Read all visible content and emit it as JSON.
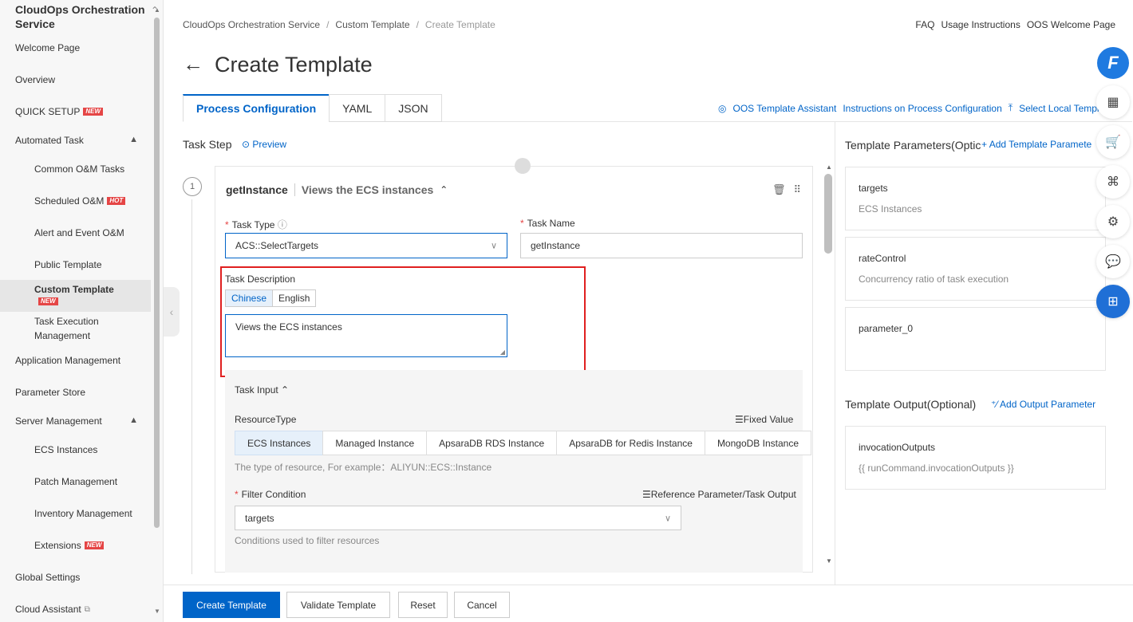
{
  "sidebar": {
    "title": "CloudOps Orchestration Service",
    "items": [
      {
        "label": "Welcome Page"
      },
      {
        "label": "Overview"
      },
      {
        "label": "QUICK SETUP",
        "badge": "NEW"
      },
      {
        "label": "Automated Task"
      },
      {
        "label": "Common O&M Tasks"
      },
      {
        "label": "Scheduled O&M",
        "badge": "HOT"
      },
      {
        "label": "Alert and Event O&M"
      },
      {
        "label": "Public Template"
      },
      {
        "label": "Custom Template",
        "badge": "NEW"
      },
      {
        "label": "Task Execution Management"
      },
      {
        "label": "Application Management"
      },
      {
        "label": "Parameter Store"
      },
      {
        "label": "Server Management"
      },
      {
        "label": "ECS Instances"
      },
      {
        "label": "Patch Management"
      },
      {
        "label": "Inventory Management"
      },
      {
        "label": "Extensions",
        "badge": "NEW"
      },
      {
        "label": "Global Settings"
      },
      {
        "label": "Cloud Assistant"
      }
    ]
  },
  "breadcrumb": [
    "CloudOps Orchestration Service",
    "Custom Template",
    "Create Template"
  ],
  "top_links": [
    "FAQ",
    "Usage Instructions",
    "OOS Welcome Page"
  ],
  "page_title": "Create Template",
  "tabs": [
    "Process Configuration",
    "YAML",
    "JSON"
  ],
  "tab_links": {
    "assistant": "OOS Template Assistant",
    "instructions": "Instructions on Process Configuration",
    "select_local": "Select Local Templ"
  },
  "task_step": {
    "label": "Task Step",
    "preview": "Preview"
  },
  "task": {
    "number": "1",
    "name": "getInstance",
    "description_title": "Views the ECS instances",
    "type_label": "Task Type",
    "type_value": "ACS::SelectTargets",
    "name_label": "Task Name",
    "name_value": "getInstance",
    "desc_label": "Task Description",
    "lang_options": [
      "Chinese",
      "English"
    ],
    "desc_value": "Views the ECS instances",
    "input_label": "Task Input",
    "resource_type_label": "ResourceType",
    "fixed_value": "Fixed Value",
    "resource_types": [
      "ECS Instances",
      "Managed Instance",
      "ApsaraDB RDS Instance",
      "ApsaraDB for Redis Instance",
      "MongoDB Instance"
    ],
    "resource_hint": "The type of resource, For example：ALIYUN::ECS::Instance",
    "filter_label": "Filter Condition",
    "reference_link": "Reference Parameter/Task Output",
    "filter_value": "targets",
    "filter_hint": "Conditions used to filter resources"
  },
  "params": {
    "title": "Template Parameters(Optic",
    "add": "Add Template Paramete",
    "items": [
      {
        "name": "targets",
        "desc": "ECS Instances"
      },
      {
        "name": "rateControl",
        "desc": "Concurrency ratio of task execution"
      },
      {
        "name": "parameter_0",
        "desc": ""
      }
    ]
  },
  "outputs": {
    "title": "Template Output(Optional)",
    "add": "Add Output Parameter",
    "items": [
      {
        "name": "invocationOutputs",
        "desc": "{{ runCommand.invocationOutputs }}"
      }
    ]
  },
  "buttons": {
    "create": "Create Template",
    "validate": "Validate Template",
    "reset": "Reset",
    "cancel": "Cancel"
  },
  "colors": {
    "primary": "#0064c8",
    "badge": "#e54545",
    "highlight": "#e02020"
  }
}
